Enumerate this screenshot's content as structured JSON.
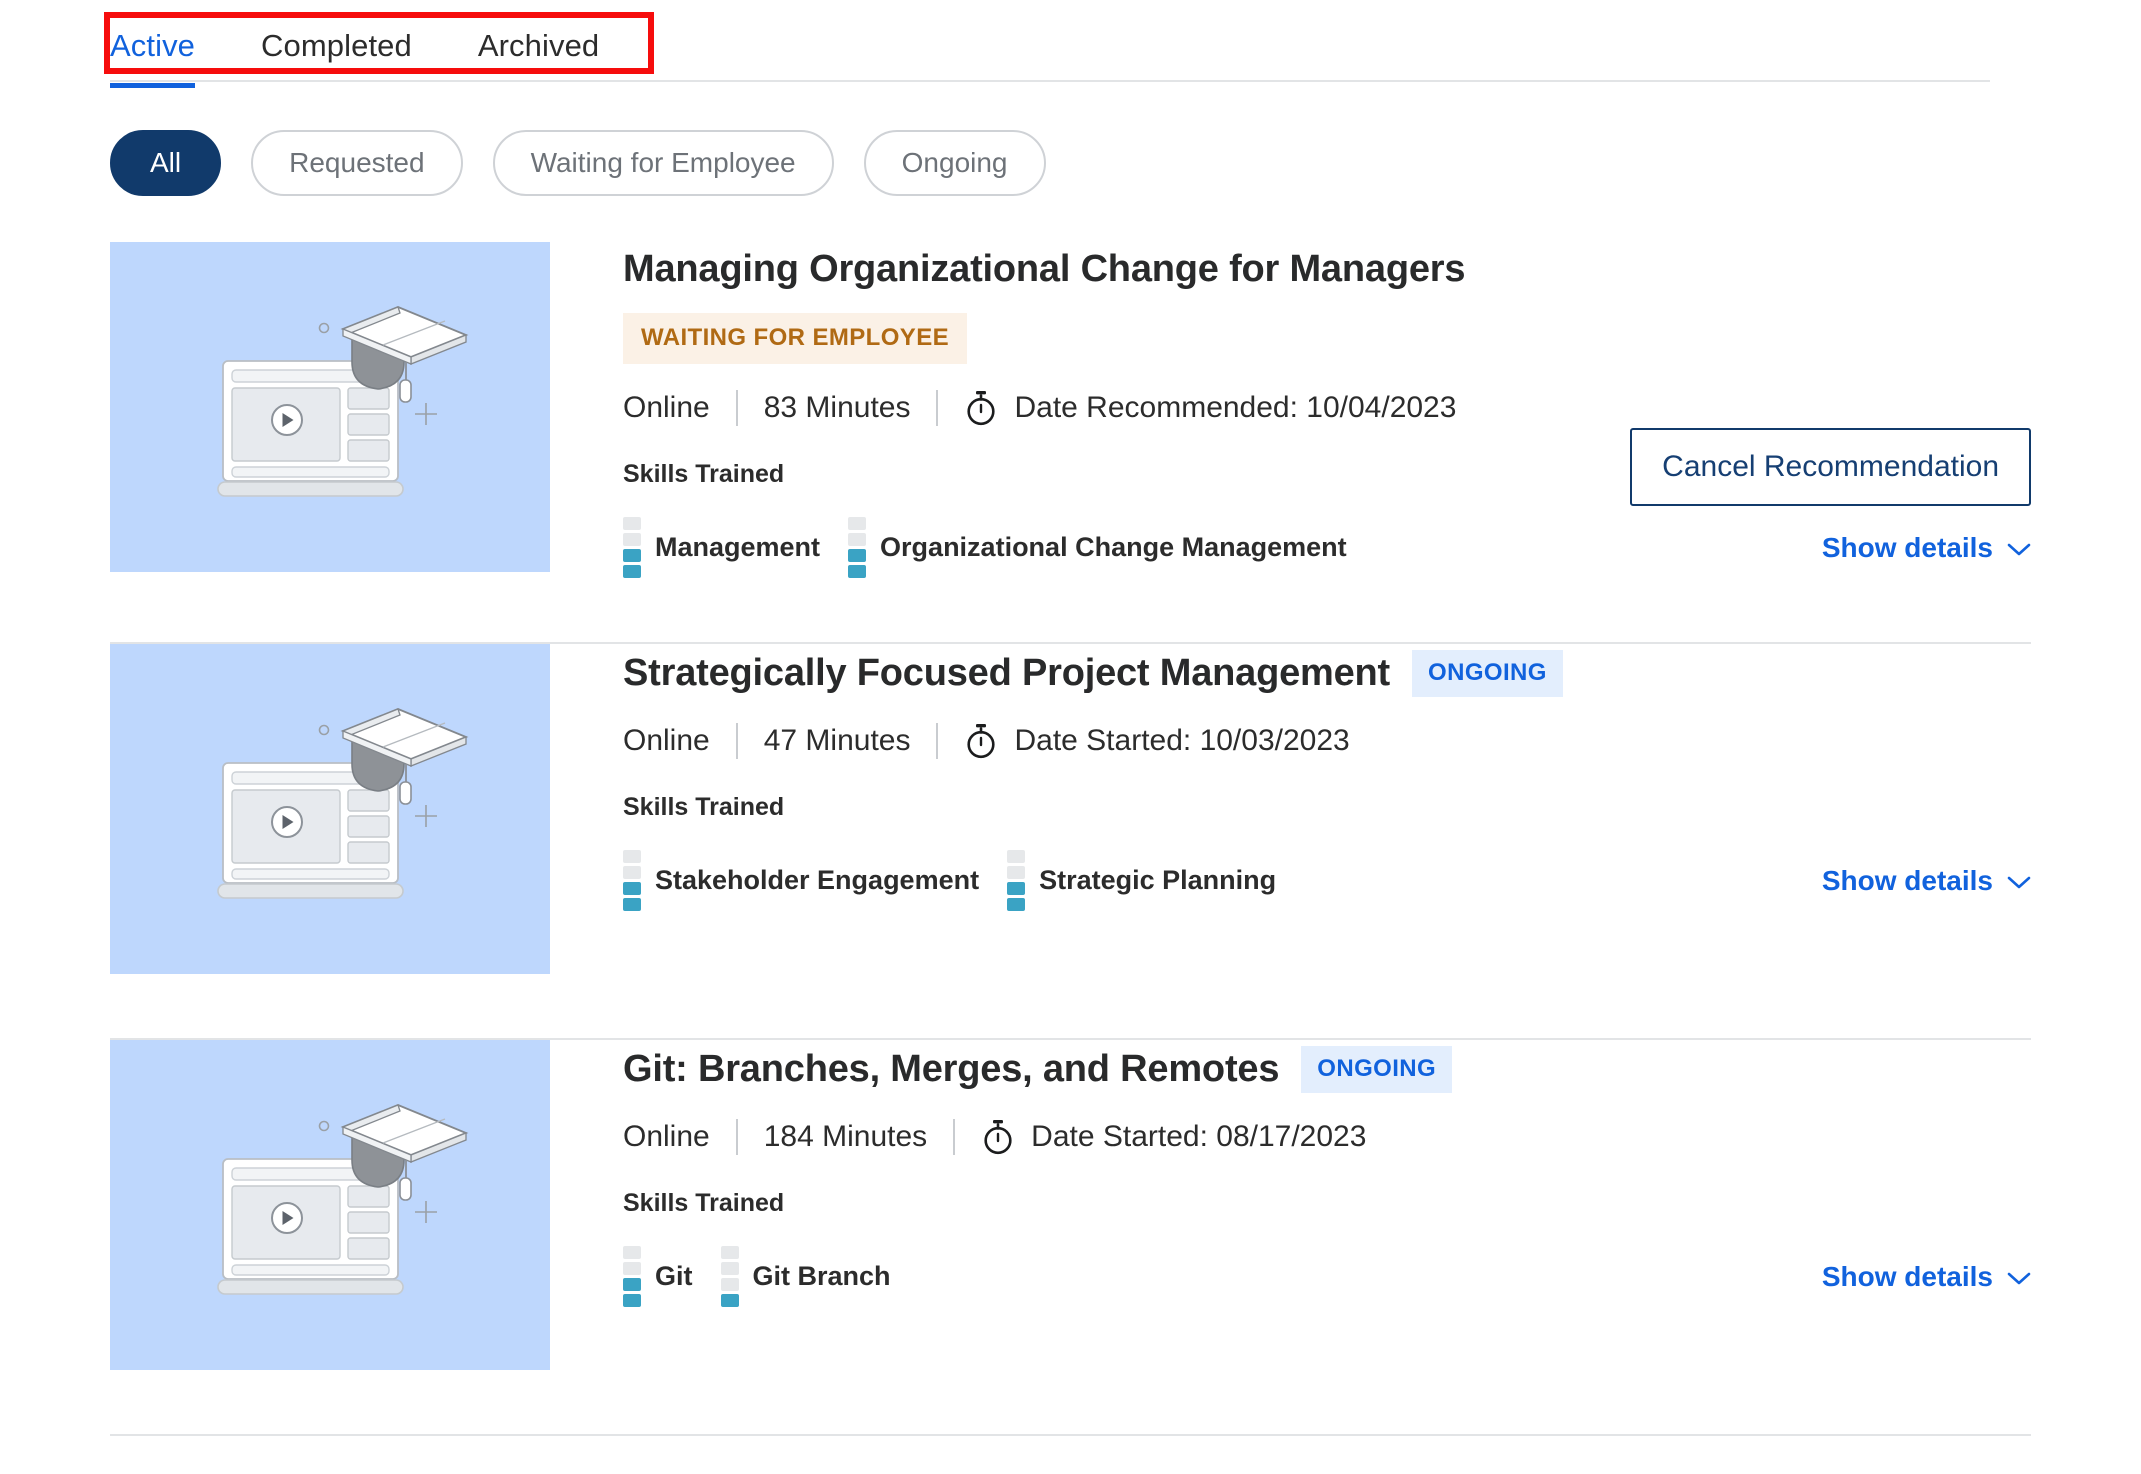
{
  "tabs": [
    {
      "label": "Active",
      "active": true
    },
    {
      "label": "Completed",
      "active": false
    },
    {
      "label": "Archived",
      "active": false
    }
  ],
  "filters": [
    {
      "label": "All",
      "selected": true
    },
    {
      "label": "Requested",
      "selected": false
    },
    {
      "label": "Waiting for Employee",
      "selected": false
    },
    {
      "label": "Ongoing",
      "selected": false
    }
  ],
  "labels": {
    "skills_trained": "Skills Trained",
    "show_details": "Show details",
    "cancel_recommendation": "Cancel Recommendation"
  },
  "colors": {
    "accent_blue": "#1162dd",
    "navy": "#113a6b",
    "badge_ongoing_bg": "#e3eefd",
    "badge_ongoing_text": "#1162dd",
    "badge_waiting_bg": "#fbf1e6",
    "badge_waiting_text": "#b06a14",
    "skill_filled": "#3aa3c4",
    "skill_empty": "#e6e8ea",
    "thumb_bg": "#bed7fd",
    "annotation_red": "#f60d0d"
  },
  "courses": [
    {
      "title": "Managing Organizational Change for Managers",
      "status_badge": "WAITING FOR EMPLOYEE",
      "badge_style": "waiting",
      "badge_inline": false,
      "modality": "Online",
      "duration": "83 Minutes",
      "date_text": "Date Recommended: 10/04/2023",
      "action_label": "Cancel Recommendation",
      "has_action": true,
      "skills": [
        {
          "name": "Management",
          "level": 2,
          "total": 4
        },
        {
          "name": "Organizational Change Management",
          "level": 2,
          "total": 4
        }
      ]
    },
    {
      "title": "Strategically Focused Project Management",
      "status_badge": "ONGOING",
      "badge_style": "ongoing",
      "badge_inline": true,
      "modality": "Online",
      "duration": "47 Minutes",
      "date_text": "Date Started: 10/03/2023",
      "has_action": false,
      "skills": [
        {
          "name": "Stakeholder Engagement",
          "level": 2,
          "total": 4
        },
        {
          "name": "Strategic Planning",
          "level": 2,
          "total": 4
        }
      ]
    },
    {
      "title": "Git: Branches, Merges, and Remotes",
      "status_badge": "ONGOING",
      "badge_style": "ongoing",
      "badge_inline": true,
      "modality": "Online",
      "duration": "184 Minutes",
      "date_text": "Date Started: 08/17/2023",
      "has_action": false,
      "skills": [
        {
          "name": "Git",
          "level": 2,
          "total": 4
        },
        {
          "name": "Git Branch",
          "level": 1,
          "total": 4
        }
      ]
    }
  ]
}
